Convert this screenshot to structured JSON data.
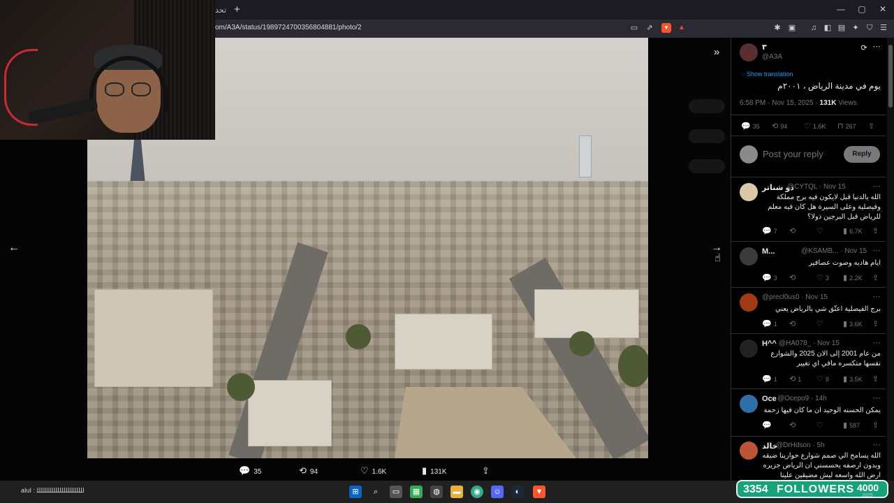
{
  "browser": {
    "tab_title": "تحد",
    "new_tab": "+",
    "url": "om/A3A/status/1989724700356804881/photo/2",
    "window_controls": [
      "—",
      "▢",
      "✕"
    ]
  },
  "viewer": {
    "prev_arrow": "←",
    "next_arrow": "→",
    "expand_icon": "»",
    "actions": {
      "replies": "35",
      "reposts": "94",
      "likes": "1.6K",
      "views": "131K"
    }
  },
  "tweet": {
    "author_name": "٣",
    "author_handle": "@A3A",
    "show_translation": "Show translation",
    "text": "يوم في مدينة الرياض ، ٢٠٠١م",
    "time": "6:58 PM · Nov 15, 2025 ·",
    "views_count": "131K",
    "views_label": "Views",
    "stats": {
      "replies": "35",
      "reposts": "94",
      "likes": "1.6K",
      "bookmarks": "267"
    },
    "reply_placeholder": "Post your reply",
    "reply_button": "Reply"
  },
  "replies": [
    {
      "name": "ذو شناتر",
      "handle": "@CYTQL · Nov 15",
      "text": "الله يالدنيا قبل لايكون فيه برج مملكة وفيصلية وعلى السيرة هل كان فيه معلم للرياض قبل البرجين ذولا؟",
      "replies": "7",
      "reposts": "",
      "likes": "",
      "views": "6.7K",
      "avatar": "#d9c9a8"
    },
    {
      "name": "M...",
      "handle": "@KSAMB... · Nov 15",
      "text": "ايام هاديه وصوت عصافير",
      "replies": "3",
      "reposts": "",
      "likes": "3",
      "views": "2.2K",
      "avatar": "#3b3b3b"
    },
    {
      "name": "",
      "handle": "@precl0us0 · Nov 15",
      "text": "برج الفيصلية اعتّق شي بالرياض يعني",
      "replies": "1",
      "reposts": "",
      "likes": "",
      "views": "3.6K",
      "avatar": "#a03a12"
    },
    {
      "name": "H^^",
      "handle": "@HA078_ · Nov 15",
      "text": "من عام 2001 إلى الان 2025 والشوارع نفسها متكسره مافي اي تغيير",
      "replies": "1",
      "reposts": "1",
      "likes": "9",
      "views": "3.5K",
      "avatar": "#222"
    },
    {
      "name": "Oce",
      "handle": "@Ocepo9 · 14h",
      "text": "يمكن الحسنه الوحيد ان ما كان فيها زحمة",
      "replies": "",
      "reposts": "",
      "likes": "",
      "views": "587",
      "avatar": "#2f6fa8"
    },
    {
      "name": "خالد",
      "handle": "@DrHdson · 5h",
      "text": "الله يسامح الي صمم شوارع حوارينا ضيقه وبدون ارصفه يحسسني ان الرياض جزيره ارض الله واسعه ليش مضيقين علينا",
      "replies": "",
      "reposts": "",
      "likes": "",
      "views": "",
      "avatar": "#b53"
    }
  ],
  "taskbar": {
    "ticker": "aIuI : ﻟﻠﻠﻠﻠﻠﻠﻠﻠﻠﻠﻠﻠﻠﻠﻠﻠﻠﻠﻠﻠﻠﻠ"
  },
  "overlay": {
    "followers_count": "3354",
    "followers_label": "FOLLOWERS",
    "followers_goal": "4000",
    "year": "2025"
  }
}
